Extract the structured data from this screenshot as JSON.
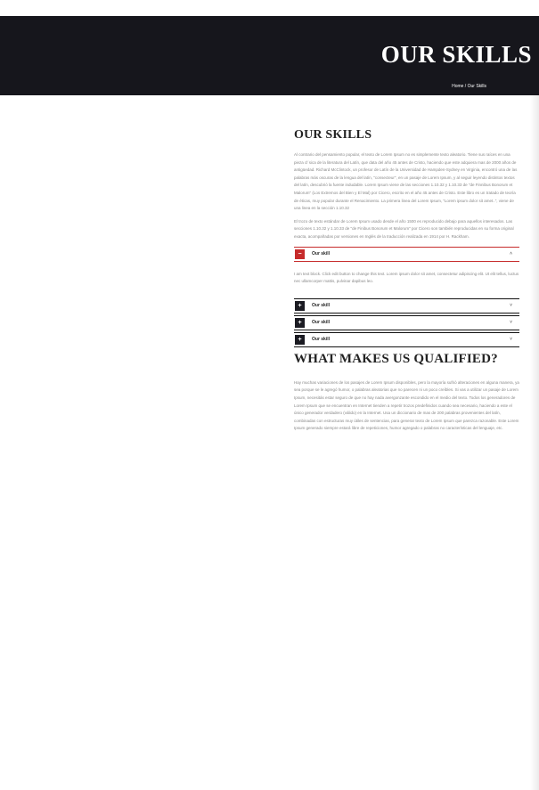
{
  "hero": {
    "title": "OUR SKILLS",
    "breadcrumb_home": "Home",
    "breadcrumb_sep": " / ",
    "breadcrumb_current": "Our Skills"
  },
  "skills": {
    "title": "OUR SKILLS",
    "para1": "Al contrario del pensamiento popular, el texto de Lorem Ipsum no es simplemente texto aleatorio. Tiene sus raíces en una pieza cl´sica de la literatura del Latín, que data del año 45 antes de Cristo, haciendo que este adquiera mas de 2000 años de antigüedad. Richard McClintock, un profesor de Latín de la Universidad de Hampden-Sydney en Virginia, encontró una de las palabras más oscuras de la lengua del latín, \"consecteur\", en un pasaje de Lorem Ipsum, y al seguir leyendo distintos textos del latín, descubrió la fuente indudable. Lorem Ipsum viene de las secciones 1.10.32 y 1.10.33 de \"de Finnibus Bonorum et Malorum\" (Los Extremos del Bien y El Mal) por Cicero, escrito en el año 45 antes de Cristo. Este libro es un tratado de teoría de éticas, muy popular durante el Renacimiento. La primera linea del Lorem Ipsum, \"Lorem ipsum dolor sit amet..\", viene de una linea en la sección 1.10.32",
    "para2": "El trozo de texto estándar de Lorem Ipsum usado desde el año 1500 es reproducido debajo para aquellos interesados. Las secciones 1.10.32 y 1.10.33 de \"de Finibus Bonorum et Malorum\" por Cicero son también reproducidas en su forma original exacta, acompañadas por versiones en Inglés de la traducción realizada en 1914 por H. Rackham."
  },
  "accordion": [
    {
      "label": "Our skill",
      "state": "open",
      "badge": "−",
      "chevron": "˄",
      "body": "I am text block. Click edit button to change this text. Lorem ipsum dolor sit amet, consectetur adipiscing elit. Ut elit tellus, luctus nec ullamcorper mattis, pulvinar dapibus leo."
    },
    {
      "label": "Our skill",
      "state": "closed",
      "badge": "+",
      "chevron": "˅"
    },
    {
      "label": "Our skill",
      "state": "closed",
      "badge": "+",
      "chevron": "˅"
    },
    {
      "label": "Our skill",
      "state": "closed",
      "badge": "+",
      "chevron": "˅"
    }
  ],
  "qualified": {
    "title": "WHAT MAKES US QUALIFIED?",
    "para": "Hay muchas variaciones de los pasajes de Lorem Ipsum disponibles, pero la mayoría sufrió alteraciones en alguna manera, ya sea porque se le agregó humor, o palabras aleatorias que no parecen ni un poco creíbles. Si vas a utilizar un pasaje de Lorem Ipsum, necesitás estar seguro de que no hay nada avergonzante escondido en el medio del texto. Todos los generadores de Lorem Ipsum que se encuentran en Internet tienden a repetir trozos predefinidos cuando sea necesario, haciendo a este el único generador verdadero (válido) en la Internet. Usa un diccionario de mas de 200 palabras provenientes del latín, combinadas con estructuras muy útiles de sentencias, para generar texto de Lorem Ipsum que parezca razonable. Este Lorem Ipsum generado siempre estará libre de repeticiones, humor agregado o palabras no características del lenguaje, etc."
  },
  "colors": {
    "hero_bg": "#16161c",
    "accent": "#c62b2b",
    "badge_dark": "#1b1b22"
  }
}
